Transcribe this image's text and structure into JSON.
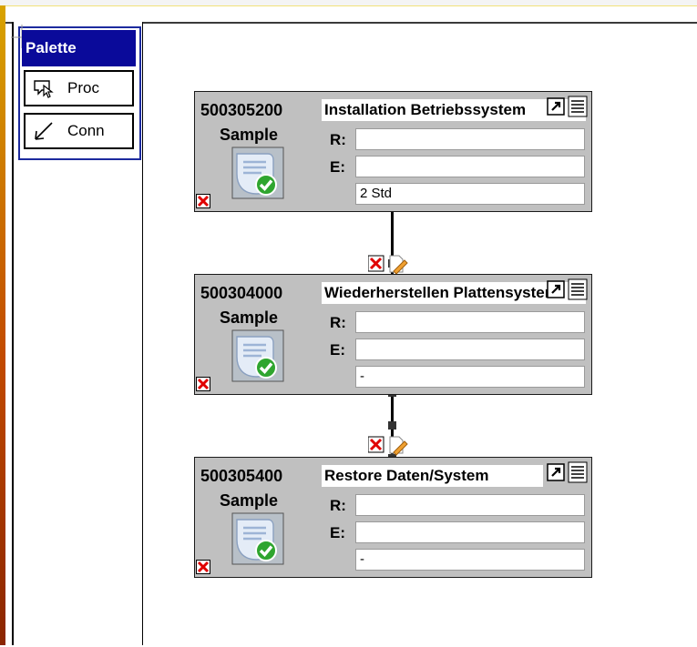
{
  "palette": {
    "title": "Palette",
    "tools": [
      {
        "label": "Proc",
        "icon": "process-tool-icon"
      },
      {
        "label": "Conn",
        "icon": "connection-arrow-icon"
      }
    ]
  },
  "nodes": [
    {
      "number": "500305200",
      "title": "Installation Betriebssystem",
      "subtitle": "Sample",
      "r_label": "R:",
      "e_label": "E:",
      "r_value": "",
      "e_value": "",
      "duration": "2 Std"
    },
    {
      "number": "500304000",
      "title": "Wiederherstellen Plattensystem",
      "subtitle": "Sample",
      "r_label": "R:",
      "e_label": "E:",
      "r_value": "",
      "e_value": "",
      "duration": "-"
    },
    {
      "number": "500305400",
      "title": "Restore Daten/System",
      "subtitle": "Sample",
      "r_label": "R:",
      "e_label": "E:",
      "r_value": "",
      "e_value": "",
      "duration": "-"
    }
  ],
  "colors": {
    "palette_header": "#0a0a9a",
    "node_bg": "#c0c0c0",
    "delete_red": "#e00000"
  }
}
